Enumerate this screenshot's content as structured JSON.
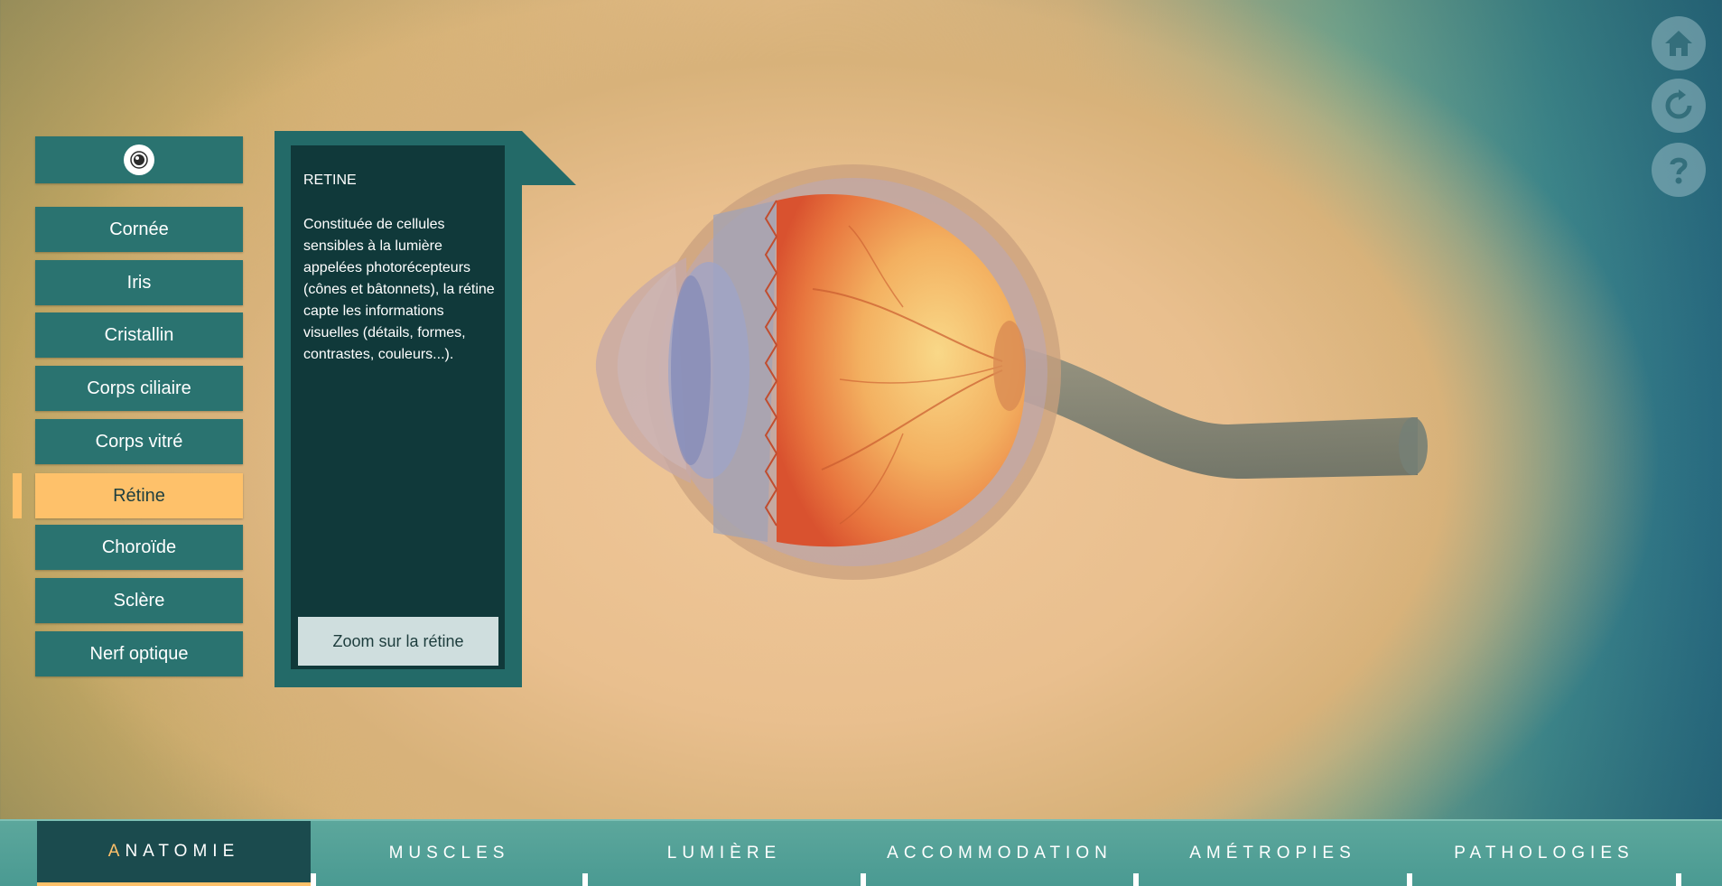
{
  "sidebar": {
    "eye_button": {
      "icon": "eye-icon"
    },
    "items": [
      {
        "label": "Cornée"
      },
      {
        "label": "Iris"
      },
      {
        "label": "Cristallin"
      },
      {
        "label": "Corps ciliaire"
      },
      {
        "label": "Corps vitré"
      },
      {
        "label": "Rétine",
        "active": true
      },
      {
        "label": "Choroïde"
      },
      {
        "label": "Sclère"
      },
      {
        "label": "Nerf optique"
      }
    ]
  },
  "info_panel": {
    "title": "RETINE",
    "text": "Constituée de cellules sensibles à la lumière appelées photorécepteurs (cônes et bâtonnets), la rétine capte les informations visuelles (détails, formes, contrastes, couleurs...).",
    "zoom_label": "Zoom sur la rétine"
  },
  "top_right": {
    "icons": [
      "home-icon",
      "refresh-icon",
      "help-icon"
    ]
  },
  "bottom_nav": {
    "active_first_letter": "A",
    "active_rest": "NATOMIE",
    "tabs": [
      {
        "label": "ANATOMIE",
        "active": true
      },
      {
        "label": "MUSCLES"
      },
      {
        "label": "LUMIÈRE"
      },
      {
        "label": "ACCOMMODATION"
      },
      {
        "label": "AMÉTROPIES"
      },
      {
        "label": "PATHOLOGIES"
      }
    ]
  },
  "colors": {
    "accent": "#fec16a",
    "button_teal": "#2a7370",
    "panel_dark": "#10393a"
  }
}
